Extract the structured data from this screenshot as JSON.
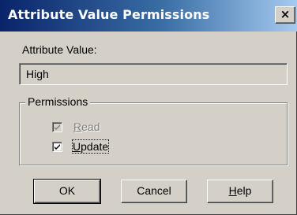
{
  "window": {
    "title": "Attribute Value Permissions",
    "close_glyph": "×"
  },
  "attribute_value": {
    "label": "Attribute Value:",
    "value": "High"
  },
  "permissions": {
    "legend": "Permissions",
    "read": {
      "prefix": "",
      "mnemonic": "R",
      "rest": "ead",
      "checked": true,
      "enabled": false
    },
    "update": {
      "prefix": "",
      "mnemonic": "U",
      "rest": "pdate",
      "checked": true,
      "enabled": true
    }
  },
  "buttons": {
    "ok": "OK",
    "cancel": "Cancel",
    "help_mnemonic": "H",
    "help_rest": "elp"
  },
  "colors": {
    "dialog_face": "#d4d0c8",
    "title_start": "#0a246a",
    "title_end": "#a6caf0",
    "disabled_text": "#808080"
  }
}
